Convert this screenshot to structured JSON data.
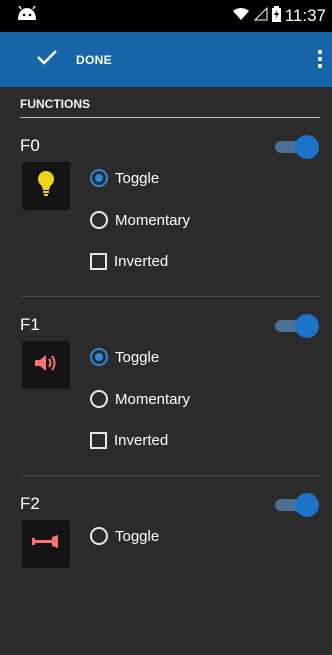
{
  "status": {
    "time": "11:37",
    "icons": [
      "android-robot-icon",
      "wifi-icon",
      "signal-icon",
      "battery-icon"
    ]
  },
  "actionbar": {
    "done_label": "DONE",
    "icons": [
      "check-icon",
      "overflow-menu-icon"
    ]
  },
  "section": {
    "title": "FUNCTIONS"
  },
  "functions": [
    {
      "name": "F0",
      "icon": "lightbulb-icon",
      "enabled": true,
      "mode": "Toggle",
      "options": {
        "toggle": "Toggle",
        "momentary": "Momentary",
        "inverted": "Inverted"
      },
      "inverted": false
    },
    {
      "name": "F1",
      "icon": "speaker-icon",
      "enabled": true,
      "mode": "Toggle",
      "options": {
        "toggle": "Toggle",
        "momentary": "Momentary",
        "inverted": "Inverted"
      },
      "inverted": false
    },
    {
      "name": "F2",
      "icon": "horn-icon",
      "enabled": true,
      "mode": "",
      "options": {
        "toggle": "Toggle"
      }
    }
  ],
  "colors": {
    "accent": "#2b8ad9",
    "actionbar": "#1565a8",
    "background": "#2b2b2b",
    "bulb": "#f2d21c",
    "speaker": "#ff7272"
  }
}
